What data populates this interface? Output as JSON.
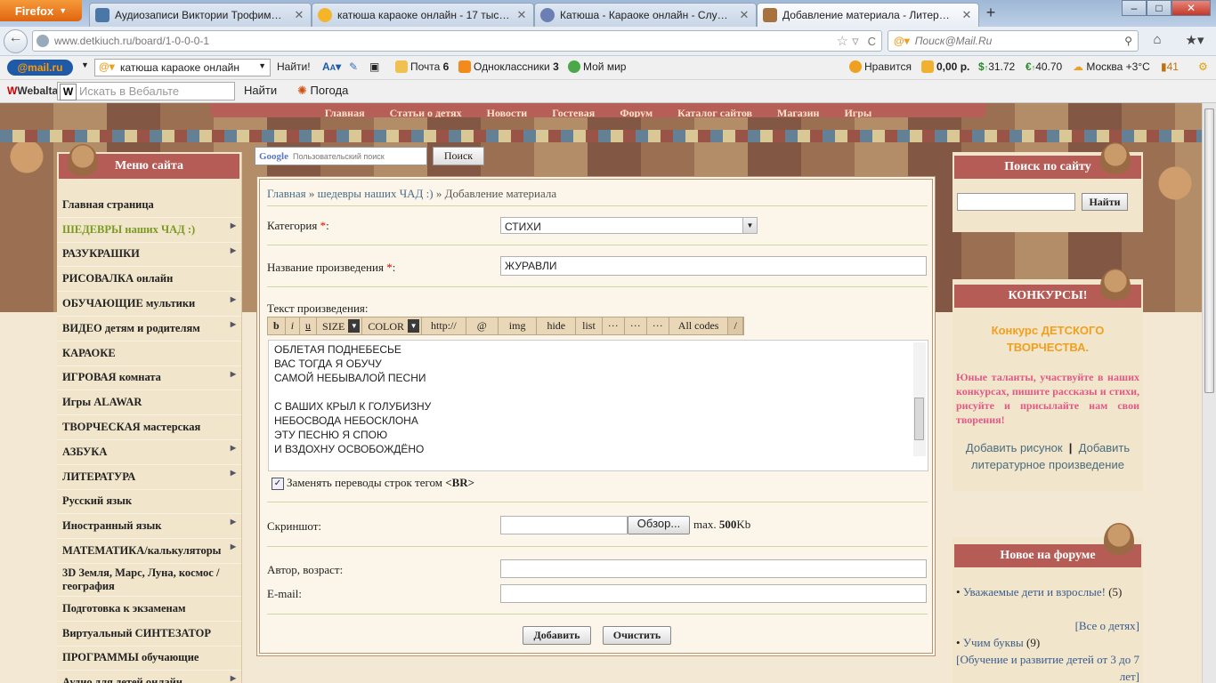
{
  "browser": {
    "app_button": "Firefox",
    "tabs": [
      {
        "title": "Аудиозаписи Виктории Трофимово...",
        "active": false
      },
      {
        "title": "катюша караоке онлайн - 17 тыс. р...",
        "active": false
      },
      {
        "title": "Катюша - Караоке онлайн - Слуша...",
        "active": false
      },
      {
        "title": "Добавление материала - Литератур...",
        "active": true
      }
    ],
    "new_tab": "+",
    "url_host": "www.detkiuch.ru",
    "url_path": "/board/1-0-0-0-1",
    "search_placeholder": "Поиск@Mail.Ru"
  },
  "mailru_toolbar": {
    "logo": "@mail.ru",
    "search_value": "катюша караоке онлайн",
    "find_label": "Найти!",
    "mail_label": "Почта",
    "mail_count": "6",
    "ok_label": "Одноклассники",
    "ok_count": "3",
    "moi_mir": "Мой мир",
    "like": "Нравится",
    "money": "0,00 р.",
    "usd": "31.72",
    "eur": "40.70",
    "weather": "Москва +3°C",
    "counter": "41"
  },
  "webalta_toolbar": {
    "logo": "Webalta",
    "search_placeholder": "Искать в Вебальте",
    "find_label": "Найти",
    "weather_label": "Погода"
  },
  "site": {
    "top_nav": [
      "Главная",
      "Статьи о детях",
      "Новости",
      "Гостевая",
      "Форум",
      "Каталог сайтов",
      "Магазин",
      "Игры"
    ],
    "menu_title": "Меню сайта",
    "menu_items": [
      {
        "label": "Главная страница",
        "sub": false,
        "accent": false
      },
      {
        "label": "ШЕДЕВРЫ наших ЧАД :)",
        "sub": true,
        "accent": true
      },
      {
        "label": "РАЗУКРАШКИ",
        "sub": true,
        "accent": false
      },
      {
        "label": "РИСОВАЛКА онлайн",
        "sub": false,
        "accent": false
      },
      {
        "label": "ОБУЧАЮЩИЕ мультики",
        "sub": true,
        "accent": false
      },
      {
        "label": "ВИДЕО детям и родителям",
        "sub": true,
        "accent": false
      },
      {
        "label": "КАРАОКЕ",
        "sub": false,
        "accent": false
      },
      {
        "label": "ИГРОВАЯ комната",
        "sub": true,
        "accent": false
      },
      {
        "label": "Игры ALAWAR",
        "sub": false,
        "accent": false
      },
      {
        "label": "ТВОРЧЕСКАЯ мастерская",
        "sub": false,
        "accent": false
      },
      {
        "label": "АЗБУКА",
        "sub": true,
        "accent": false
      },
      {
        "label": "ЛИТЕРАТУРА",
        "sub": true,
        "accent": false
      },
      {
        "label": "Русский язык",
        "sub": false,
        "accent": false
      },
      {
        "label": "Иностранный язык",
        "sub": true,
        "accent": false
      },
      {
        "label": "МАТЕМАТИКА/калькуляторы",
        "sub": true,
        "accent": false
      },
      {
        "label": "3D Земля, Марс, Луна, космос / география",
        "sub": false,
        "accent": false
      },
      {
        "label": "Подготовка к экзаменам",
        "sub": false,
        "accent": false
      },
      {
        "label": "Виртуальный СИНТЕЗАТОР",
        "sub": false,
        "accent": false
      },
      {
        "label": "ПРОГРАММЫ обучающие",
        "sub": false,
        "accent": false
      },
      {
        "label": "Аудио для детей онлайн",
        "sub": true,
        "accent": false
      }
    ],
    "google_placeholder": "Пользовательский поиск",
    "google_button": "Поиск",
    "breadcrumb": {
      "home": "Главная",
      "sep": " » ",
      "section": "шедевры наших ЧАД :)",
      "current": "Добавление материала"
    },
    "form": {
      "category_label": "Категория",
      "category_value": "СТИХИ",
      "title_label": "Название произведения",
      "title_value": "ЖУРАВЛИ",
      "text_label": "Текст произведения:",
      "bbcodes": [
        "b",
        "i",
        "u",
        "SIZE",
        "COLOR",
        "http://",
        "@",
        "img",
        "hide",
        "list",
        "···",
        "···",
        "···",
        "All codes",
        "/"
      ],
      "text_lines": [
        "ОБЛЕТАЯ ПОДНЕБЕСЬЕ",
        "ВАС ТОГДА Я ОБУЧУ",
        "САМОЙ НЕБЫВАЛОЙ ПЕСНИ",
        "",
        "С ВАШИХ КРЫЛ К ГОЛУБИЗНУ",
        "НЕБОСВОДА НЕБОСКЛОНА",
        "ЭТУ ПЕСНЮ Я СПОЮ",
        "И ВЗДОХНУ ОСВОБОЖДЁНО"
      ],
      "br_check_label": "Заменять переводы строк тегом",
      "br_tag": "<BR>",
      "screenshot_label": "Скриншот:",
      "browse_button": "Обзор...",
      "max_size_prefix": "max.",
      "max_size": "500",
      "max_size_unit": "Kb",
      "author_label": "Автор, возраст:",
      "email_label": "E-mail:",
      "submit_button": "Добавить",
      "clear_button": "Очистить"
    },
    "site_search": {
      "title": "Поиск по сайту",
      "button": "Найти"
    },
    "contest": {
      "title": "КОНКУРСЫ!",
      "headline_1": "Конкурс ДЕТСКОГО",
      "headline_2": "ТВОРЧЕСТВА.",
      "body": "Юные таланты, участвуйте в наших конкурсах, пишите рассказы и стихи, рисуйте и присылайте нам свои творения!",
      "link_drawing": "Добавить рисунок",
      "link_sep": "|",
      "link_literature_1": "Добавить",
      "link_literature_2": "литературное произведение"
    },
    "forum": {
      "title": "Новое на форуме",
      "posts": [
        {
          "title": "Уважаемые дети и взрослые!",
          "count": "(5)",
          "category": "[Все о детях]"
        },
        {
          "title": "Учим буквы",
          "count": "(9)",
          "category": "[Обучение и развитие детей от 3 до 7 лет]"
        }
      ]
    }
  }
}
